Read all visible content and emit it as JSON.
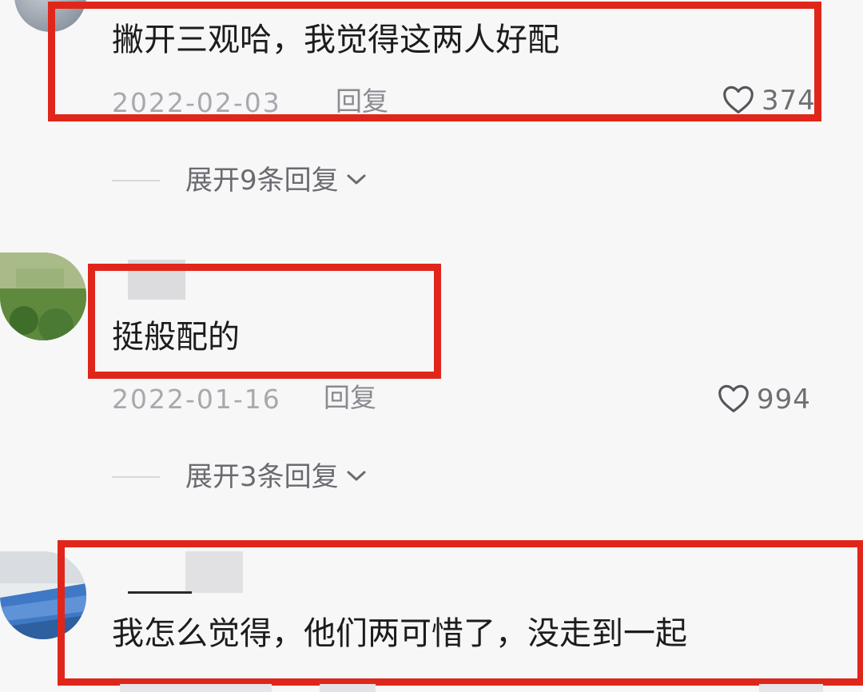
{
  "comments": [
    {
      "text": "撇开三观哈，我觉得这两人好配",
      "date": "2022-02-03",
      "reply": "回复",
      "likes": "374",
      "expand": "展开9条回复"
    },
    {
      "text": "挺般配的",
      "date": "2022-01-16",
      "reply": "回复",
      "likes": "994",
      "expand": "展开3条回复"
    },
    {
      "text": "我怎么觉得，他们两可惜了，没走到一起",
      "date": "",
      "reply": "",
      "likes": ""
    }
  ],
  "colors": {
    "highlight_box": "#e0261b",
    "background": "#f7f7f8",
    "meta_text": "#a8a8ae"
  },
  "icons": {
    "like": "heart-outline-icon",
    "expand": "chevron-down-icon"
  }
}
